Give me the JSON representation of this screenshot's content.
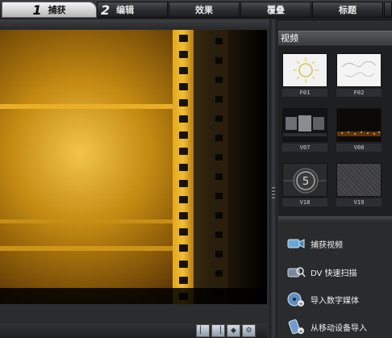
{
  "tabs": [
    {
      "num": "1",
      "label": "捕获",
      "active": true
    },
    {
      "num": "2",
      "label": "编辑",
      "active": false
    },
    {
      "label": "效果"
    },
    {
      "label": "覆叠"
    },
    {
      "label": "标题"
    }
  ],
  "library": {
    "title": "视频",
    "thumbs": [
      "F01",
      "F02",
      "V07",
      "V08",
      "V18",
      "V19"
    ]
  },
  "countdown_digit": "5",
  "actions": [
    {
      "label": "捕获视频",
      "icon": "video-camera-icon"
    },
    {
      "label": "DV 快速扫描",
      "icon": "dv-scan-icon"
    },
    {
      "label": "导入数字媒体",
      "icon": "import-disc-icon"
    },
    {
      "label": "从移动设备导入",
      "icon": "mobile-device-icon"
    }
  ],
  "colors": {
    "film_gold": "#e0a21a",
    "panel_bg": "#2b2c2e"
  }
}
